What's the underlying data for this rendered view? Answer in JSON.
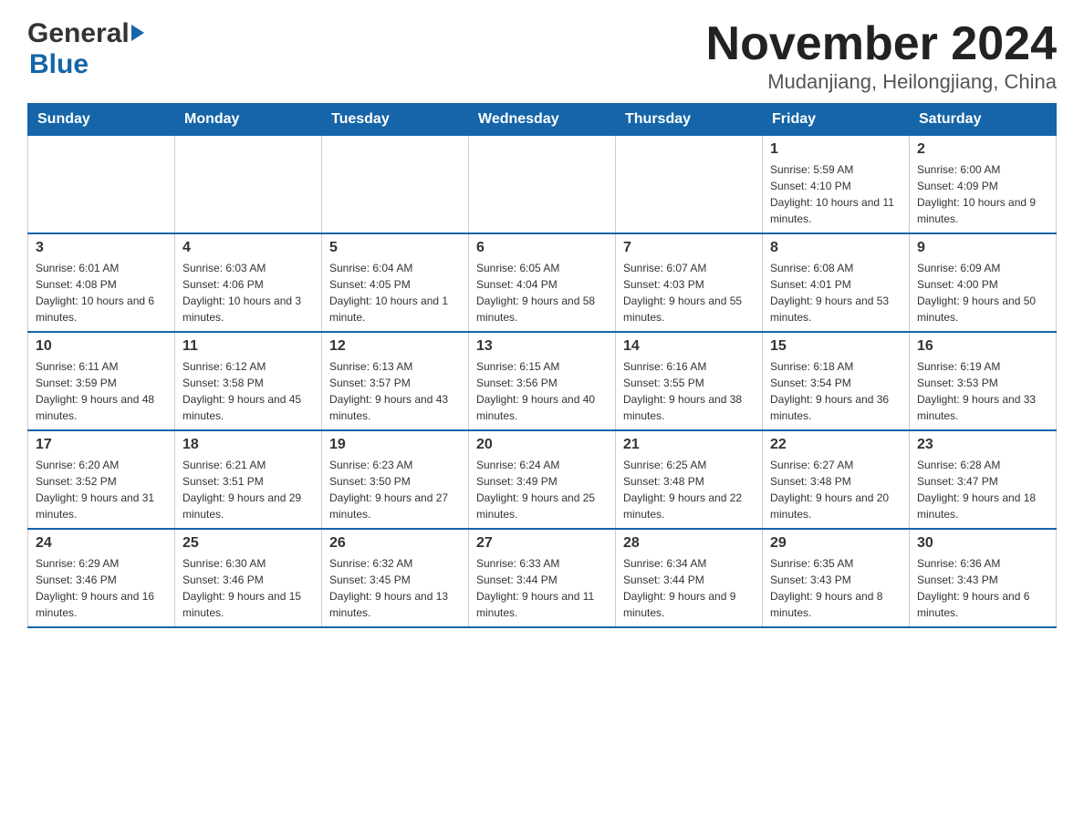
{
  "logo": {
    "general": "General",
    "blue": "Blue"
  },
  "title": "November 2024",
  "subtitle": "Mudanjiang, Heilongjiang, China",
  "weekdays": [
    "Sunday",
    "Monday",
    "Tuesday",
    "Wednesday",
    "Thursday",
    "Friday",
    "Saturday"
  ],
  "weeks": [
    [
      {
        "day": "",
        "info": ""
      },
      {
        "day": "",
        "info": ""
      },
      {
        "day": "",
        "info": ""
      },
      {
        "day": "",
        "info": ""
      },
      {
        "day": "",
        "info": ""
      },
      {
        "day": "1",
        "info": "Sunrise: 5:59 AM\nSunset: 4:10 PM\nDaylight: 10 hours and 11 minutes."
      },
      {
        "day": "2",
        "info": "Sunrise: 6:00 AM\nSunset: 4:09 PM\nDaylight: 10 hours and 9 minutes."
      }
    ],
    [
      {
        "day": "3",
        "info": "Sunrise: 6:01 AM\nSunset: 4:08 PM\nDaylight: 10 hours and 6 minutes."
      },
      {
        "day": "4",
        "info": "Sunrise: 6:03 AM\nSunset: 4:06 PM\nDaylight: 10 hours and 3 minutes."
      },
      {
        "day": "5",
        "info": "Sunrise: 6:04 AM\nSunset: 4:05 PM\nDaylight: 10 hours and 1 minute."
      },
      {
        "day": "6",
        "info": "Sunrise: 6:05 AM\nSunset: 4:04 PM\nDaylight: 9 hours and 58 minutes."
      },
      {
        "day": "7",
        "info": "Sunrise: 6:07 AM\nSunset: 4:03 PM\nDaylight: 9 hours and 55 minutes."
      },
      {
        "day": "8",
        "info": "Sunrise: 6:08 AM\nSunset: 4:01 PM\nDaylight: 9 hours and 53 minutes."
      },
      {
        "day": "9",
        "info": "Sunrise: 6:09 AM\nSunset: 4:00 PM\nDaylight: 9 hours and 50 minutes."
      }
    ],
    [
      {
        "day": "10",
        "info": "Sunrise: 6:11 AM\nSunset: 3:59 PM\nDaylight: 9 hours and 48 minutes."
      },
      {
        "day": "11",
        "info": "Sunrise: 6:12 AM\nSunset: 3:58 PM\nDaylight: 9 hours and 45 minutes."
      },
      {
        "day": "12",
        "info": "Sunrise: 6:13 AM\nSunset: 3:57 PM\nDaylight: 9 hours and 43 minutes."
      },
      {
        "day": "13",
        "info": "Sunrise: 6:15 AM\nSunset: 3:56 PM\nDaylight: 9 hours and 40 minutes."
      },
      {
        "day": "14",
        "info": "Sunrise: 6:16 AM\nSunset: 3:55 PM\nDaylight: 9 hours and 38 minutes."
      },
      {
        "day": "15",
        "info": "Sunrise: 6:18 AM\nSunset: 3:54 PM\nDaylight: 9 hours and 36 minutes."
      },
      {
        "day": "16",
        "info": "Sunrise: 6:19 AM\nSunset: 3:53 PM\nDaylight: 9 hours and 33 minutes."
      }
    ],
    [
      {
        "day": "17",
        "info": "Sunrise: 6:20 AM\nSunset: 3:52 PM\nDaylight: 9 hours and 31 minutes."
      },
      {
        "day": "18",
        "info": "Sunrise: 6:21 AM\nSunset: 3:51 PM\nDaylight: 9 hours and 29 minutes."
      },
      {
        "day": "19",
        "info": "Sunrise: 6:23 AM\nSunset: 3:50 PM\nDaylight: 9 hours and 27 minutes."
      },
      {
        "day": "20",
        "info": "Sunrise: 6:24 AM\nSunset: 3:49 PM\nDaylight: 9 hours and 25 minutes."
      },
      {
        "day": "21",
        "info": "Sunrise: 6:25 AM\nSunset: 3:48 PM\nDaylight: 9 hours and 22 minutes."
      },
      {
        "day": "22",
        "info": "Sunrise: 6:27 AM\nSunset: 3:48 PM\nDaylight: 9 hours and 20 minutes."
      },
      {
        "day": "23",
        "info": "Sunrise: 6:28 AM\nSunset: 3:47 PM\nDaylight: 9 hours and 18 minutes."
      }
    ],
    [
      {
        "day": "24",
        "info": "Sunrise: 6:29 AM\nSunset: 3:46 PM\nDaylight: 9 hours and 16 minutes."
      },
      {
        "day": "25",
        "info": "Sunrise: 6:30 AM\nSunset: 3:46 PM\nDaylight: 9 hours and 15 minutes."
      },
      {
        "day": "26",
        "info": "Sunrise: 6:32 AM\nSunset: 3:45 PM\nDaylight: 9 hours and 13 minutes."
      },
      {
        "day": "27",
        "info": "Sunrise: 6:33 AM\nSunset: 3:44 PM\nDaylight: 9 hours and 11 minutes."
      },
      {
        "day": "28",
        "info": "Sunrise: 6:34 AM\nSunset: 3:44 PM\nDaylight: 9 hours and 9 minutes."
      },
      {
        "day": "29",
        "info": "Sunrise: 6:35 AM\nSunset: 3:43 PM\nDaylight: 9 hours and 8 minutes."
      },
      {
        "day": "30",
        "info": "Sunrise: 6:36 AM\nSunset: 3:43 PM\nDaylight: 9 hours and 6 minutes."
      }
    ]
  ]
}
